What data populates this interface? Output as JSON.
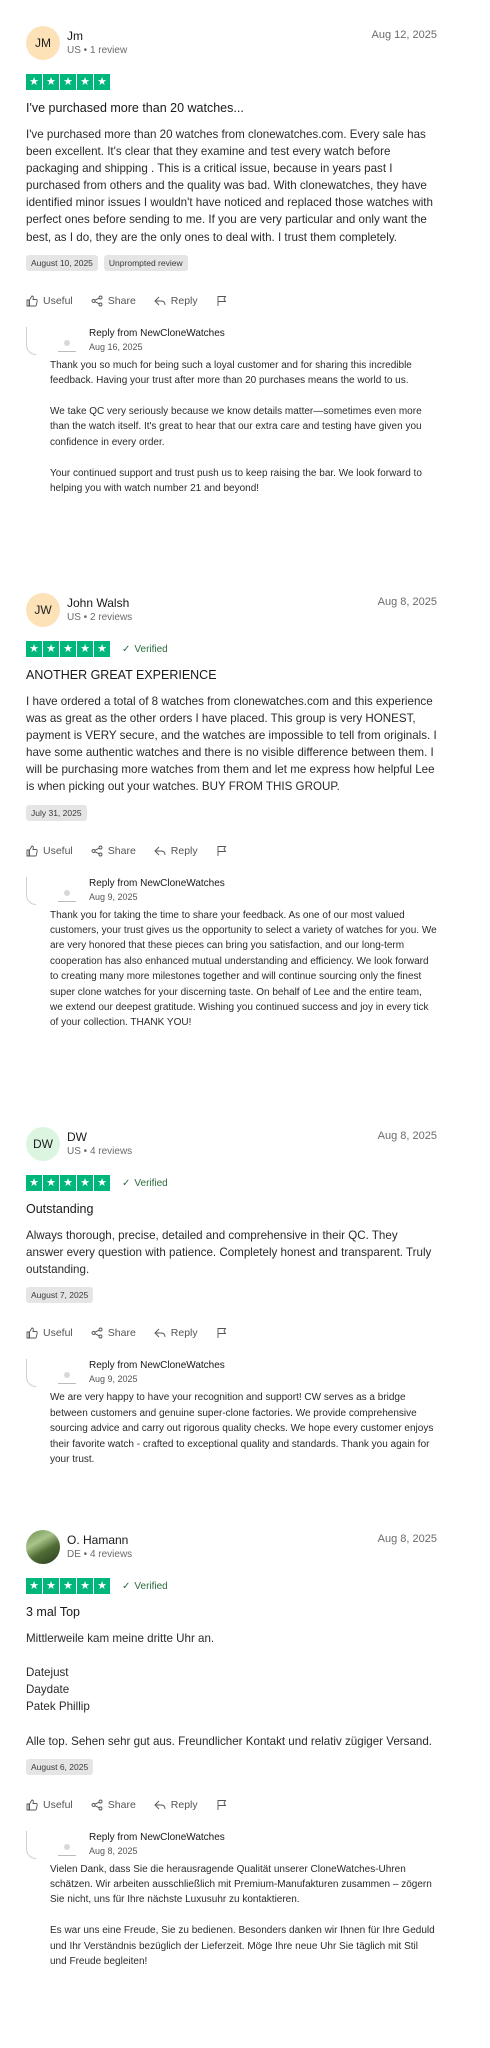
{
  "reviews": [
    {
      "initials": "JM",
      "avatar_color": "#fde2b8",
      "name": "Jm",
      "sub": "US • 1 review",
      "date": "Aug 12, 2025",
      "stars": 5,
      "verified": "",
      "title": "I've purchased more than 20 watches...",
      "body": "I've purchased more than 20 watches from clonewatches.com. Every sale has been excellent. It's clear that they examine and test every watch before packaging and shipping . This is a critical issue, because in years past I purchased from others and the quality was bad. With clonewatches, they have identified minor issues I wouldn't have noticed and replaced those watches with perfect ones before sending to me. If you are very particular and only want the best, as I do, they are the only ones to deal with. I trust them completely.",
      "tags": [
        "August 10, 2025",
        "Unprompted review"
      ],
      "actions": {
        "useful": "Useful",
        "share": "Share",
        "reply": "Reply"
      },
      "reply": {
        "name": "Reply from NewCloneWatches",
        "date": "Aug 16, 2025",
        "body": "Thank you so much for being such a loyal customer and for sharing this incredible feedback. Having your trust after more than 20 purchases means the world to us.\n\nWe take QC very seriously because we know details matter—sometimes even more than the watch itself. It's great to hear that our extra care and testing have given you confidence in every order.\n\nYour continued support and trust push us to keep raising the bar. We look forward to helping you with watch number 21 and beyond!"
      }
    },
    {
      "initials": "JW",
      "avatar_color": "#fde2b8",
      "name": "John Walsh",
      "sub": "US • 2 reviews",
      "date": "Aug 8, 2025",
      "stars": 5,
      "verified": "Verified",
      "title": "ANOTHER GREAT EXPERIENCE",
      "body": "I have ordered a total of 8 watches from clonewatches.com and this experience was as great as the other orders I have placed. This group is very HONEST, payment is VERY secure, and the watches are impossible to tell from originals. I have some authentic watches and there is no visible difference between them. I will be purchasing more watches from them and let me express how helpful Lee is when picking out your watches. BUY FROM THIS GROUP.",
      "tags": [
        "July 31, 2025"
      ],
      "actions": {
        "useful": "Useful",
        "share": "Share",
        "reply": "Reply"
      },
      "reply": {
        "name": "Reply from NewCloneWatches",
        "date": "Aug 9, 2025",
        "body": "Thank you for taking the time to share your feedback. As one of our most valued customers, your trust gives us the opportunity to select a variety of watches for you. We are very honored that these pieces can bring you satisfaction, and our long-term cooperation has also enhanced mutual understanding and efficiency. We look forward to creating many more milestones together and will continue sourcing only the finest super clone watches for your discerning taste. On behalf of Lee and the entire team, we extend our deepest gratitude. Wishing you continued success and joy in every tick of your collection. THANK YOU!"
      }
    },
    {
      "initials": "DW",
      "avatar_color": "#dcf5e1",
      "name": "DW",
      "sub": "US • 4 reviews",
      "date": "Aug 8, 2025",
      "stars": 5,
      "verified": "Verified",
      "title": "Outstanding",
      "body": "Always thorough, precise, detailed and comprehensive in their QC. They answer every question with patience. Completely honest and transparent. Truly outstanding.",
      "tags": [
        "August 7, 2025"
      ],
      "actions": {
        "useful": "Useful",
        "share": "Share",
        "reply": "Reply"
      },
      "reply": {
        "name": "Reply from NewCloneWatches",
        "date": "Aug 9, 2025",
        "body": "We are very happy to have your recognition and support! CW serves as a bridge between customers and genuine super-clone factories. We provide comprehensive sourcing advice and carry out rigorous quality checks. We hope every customer enjoys their favorite watch - crafted to exceptional quality and standards. Thank you again for your trust."
      }
    },
    {
      "initials": "",
      "avatar_color": "#6c8e4e",
      "name": "O. Hamann",
      "sub": "DE • 4 reviews",
      "date": "Aug 8, 2025",
      "stars": 5,
      "verified": "Verified",
      "title": "3 mal Top",
      "body": "Mittlerweile kam meine dritte Uhr an.\n\nDatejust\nDaydate\nPatek Phillip\n\nAlle top. Sehen sehr gut aus. Freundlicher Kontakt und relativ zügiger Versand.\n",
      "tags": [
        "August 6, 2025"
      ],
      "actions": {
        "useful": "Useful",
        "share": "Share",
        "reply": "Reply"
      },
      "reply": {
        "name": "Reply from NewCloneWatches",
        "date": "Aug 8, 2025",
        "body": "Vielen Dank, dass Sie die herausragende Qualität unserer CloneWatches-Uhren schätzen. Wir arbeiten ausschließlich mit Premium-Manufakturen zusammen – zögern Sie nicht, uns für Ihre nächste Luxusuhr zu kontaktieren.\n\nEs war uns eine Freude, Sie zu bedienen. Besonders danken wir Ihnen für Ihre Geduld und Ihr Verständnis bezüglich der Lieferzeit. Möge Ihre neue Uhr Sie täglich mit Stil und Freude begleiten!"
      }
    }
  ]
}
